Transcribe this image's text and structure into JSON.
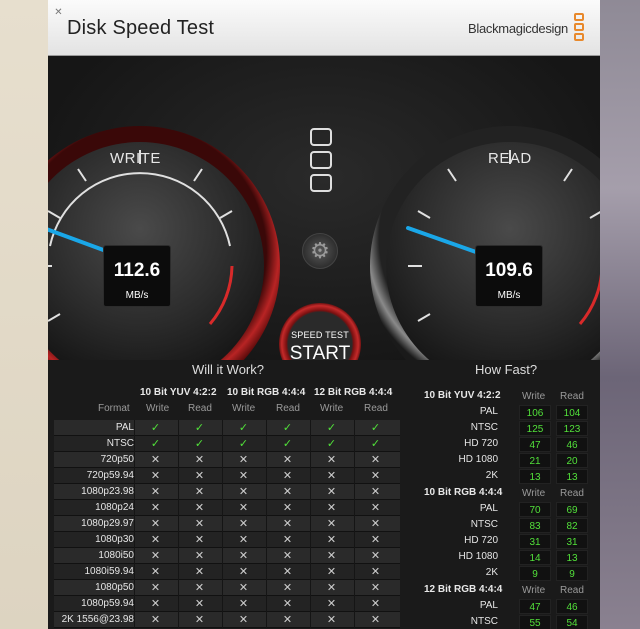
{
  "window": {
    "title": "Disk Speed Test",
    "brand": "Blackmagicdesign",
    "close_glyph": "✕"
  },
  "gauges": {
    "write": {
      "label": "WRITE",
      "value": "112.6",
      "unit": "MB/s"
    },
    "read": {
      "label": "READ",
      "value": "109.6",
      "unit": "MB/s"
    }
  },
  "controls": {
    "start_line1": "SPEED TEST",
    "start_line2": "START",
    "gear_glyph": "⚙"
  },
  "will_it_work": {
    "title": "Will it Work?",
    "groups": [
      "10 Bit YUV 4:2:2",
      "10 Bit RGB 4:4:4",
      "12 Bit RGB 4:4:4"
    ],
    "sub": {
      "format": "Format",
      "write": "Write",
      "read": "Read"
    },
    "rows": [
      {
        "format": "PAL",
        "cells": [
          1,
          1,
          1,
          1,
          1,
          1
        ]
      },
      {
        "format": "NTSC",
        "cells": [
          1,
          1,
          1,
          1,
          1,
          1
        ]
      },
      {
        "format": "720p50",
        "cells": [
          0,
          0,
          0,
          0,
          0,
          0
        ]
      },
      {
        "format": "720p59.94",
        "cells": [
          0,
          0,
          0,
          0,
          0,
          0
        ]
      },
      {
        "format": "1080p23.98",
        "cells": [
          0,
          0,
          0,
          0,
          0,
          0
        ]
      },
      {
        "format": "1080p24",
        "cells": [
          0,
          0,
          0,
          0,
          0,
          0
        ]
      },
      {
        "format": "1080p29.97",
        "cells": [
          0,
          0,
          0,
          0,
          0,
          0
        ]
      },
      {
        "format": "1080p30",
        "cells": [
          0,
          0,
          0,
          0,
          0,
          0
        ]
      },
      {
        "format": "1080i50",
        "cells": [
          0,
          0,
          0,
          0,
          0,
          0
        ]
      },
      {
        "format": "1080i59.94",
        "cells": [
          0,
          0,
          0,
          0,
          0,
          0
        ]
      },
      {
        "format": "1080p50",
        "cells": [
          0,
          0,
          0,
          0,
          0,
          0
        ]
      },
      {
        "format": "1080p59.94",
        "cells": [
          0,
          0,
          0,
          0,
          0,
          0
        ]
      },
      {
        "format": "2K 1556@23.98",
        "cells": [
          0,
          0,
          0,
          0,
          0,
          0
        ]
      }
    ],
    "check_glyph": "✓",
    "cross_glyph": "✕"
  },
  "how_fast": {
    "title": "How Fast?",
    "write_label": "Write",
    "read_label": "Read",
    "groups": [
      {
        "name": "10 Bit YUV 4:2:2",
        "rows": [
          {
            "format": "PAL",
            "write": "106",
            "read": "104"
          },
          {
            "format": "NTSC",
            "write": "125",
            "read": "123"
          },
          {
            "format": "HD 720",
            "write": "47",
            "read": "46"
          },
          {
            "format": "HD 1080",
            "write": "21",
            "read": "20"
          },
          {
            "format": "2K",
            "write": "13",
            "read": "13"
          }
        ]
      },
      {
        "name": "10 Bit RGB 4:4:4",
        "rows": [
          {
            "format": "PAL",
            "write": "70",
            "read": "69"
          },
          {
            "format": "NTSC",
            "write": "83",
            "read": "82"
          },
          {
            "format": "HD 720",
            "write": "31",
            "read": "31"
          },
          {
            "format": "HD 1080",
            "write": "14",
            "read": "13"
          },
          {
            "format": "2K",
            "write": "9",
            "read": "9"
          }
        ]
      },
      {
        "name": "12 Bit RGB 4:4:4",
        "rows": [
          {
            "format": "PAL",
            "write": "47",
            "read": "46"
          },
          {
            "format": "NTSC",
            "write": "55",
            "read": "54"
          }
        ]
      }
    ]
  },
  "colors": {
    "accent_red": "#d82a2a",
    "needle": "#1aa7e8",
    "ok": "#51e13a",
    "logo": "#e8892c"
  }
}
